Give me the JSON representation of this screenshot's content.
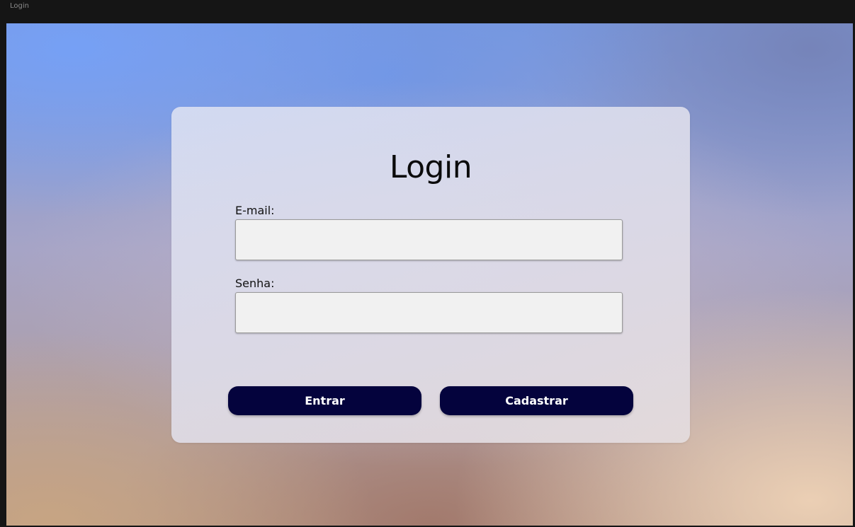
{
  "window": {
    "title": "Login"
  },
  "card": {
    "title": "Login",
    "email_label": "E-mail:",
    "email_value": "",
    "password_label": "Senha:",
    "password_value": "",
    "login_button": "Entrar",
    "register_button": "Cadastrar"
  },
  "colors": {
    "button_bg": "#04033d",
    "button_text": "#ffffff",
    "input_bg": "#f1f1f1",
    "title_text": "#0b0b0b"
  }
}
